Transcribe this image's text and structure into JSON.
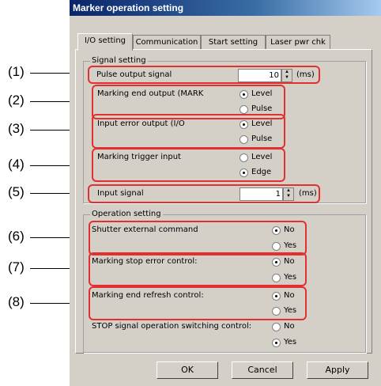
{
  "window": {
    "title": "Marker operation setting"
  },
  "tabs": [
    "I/O setting",
    "Communication",
    "Start setting",
    "Laser pwr chk"
  ],
  "signal_setting": {
    "title": "Signal setting",
    "pulse_output_label": "Pulse output signal",
    "pulse_output_value": "10",
    "pulse_output_unit": "(ms)",
    "marking_end_label": "Marking end output (MARK",
    "input_error_label": "Input error output (I/O",
    "marking_trigger_label": "Marking trigger input",
    "input_signal_label": "Input signal",
    "input_signal_value": "1",
    "input_signal_unit": "(ms)",
    "opt_level": "Level",
    "opt_pulse": "Pulse",
    "opt_edge": "Edge"
  },
  "operation_setting": {
    "title": "Operation setting",
    "shutter_label": "Shutter external command",
    "stop_error_label": "Marking stop error control:",
    "end_refresh_label": "Marking end refresh control:",
    "stop_switch_label": "STOP signal operation switching control:",
    "opt_no": "No",
    "opt_yes": "Yes"
  },
  "buttons": {
    "ok": "OK",
    "cancel": "Cancel",
    "apply": "Apply"
  },
  "annotations": [
    "(1)",
    "(2)",
    "(3)",
    "(4)",
    "(5)",
    "(6)",
    "(7)",
    "(8)"
  ],
  "colors": {
    "highlight": "#e23030",
    "dialog": "#d4d0c8",
    "titlebar": "#0a246a"
  }
}
